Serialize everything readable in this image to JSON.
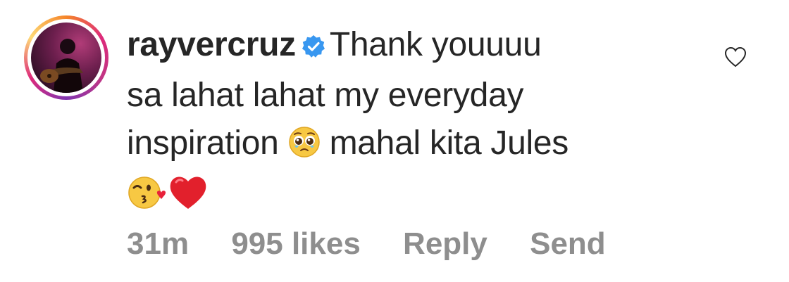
{
  "comment": {
    "username": "rayvercruz",
    "verified": true,
    "line1_text": "Thank youuuu",
    "line2_text": "sa lahat lahat my everyday",
    "line3_before_emoji": "inspiration",
    "line3_after_emoji": "mahal kita Jules",
    "emojis": [
      "pleading-face-emoji",
      "kissing-face-emoji",
      "red-heart-emoji"
    ]
  },
  "meta": {
    "time": "31m",
    "likes": "995 likes",
    "reply_label": "Reply",
    "send_label": "Send"
  },
  "colors": {
    "text": "#262626",
    "meta": "#8e8e8e",
    "verified_blue": "#3897f0"
  }
}
